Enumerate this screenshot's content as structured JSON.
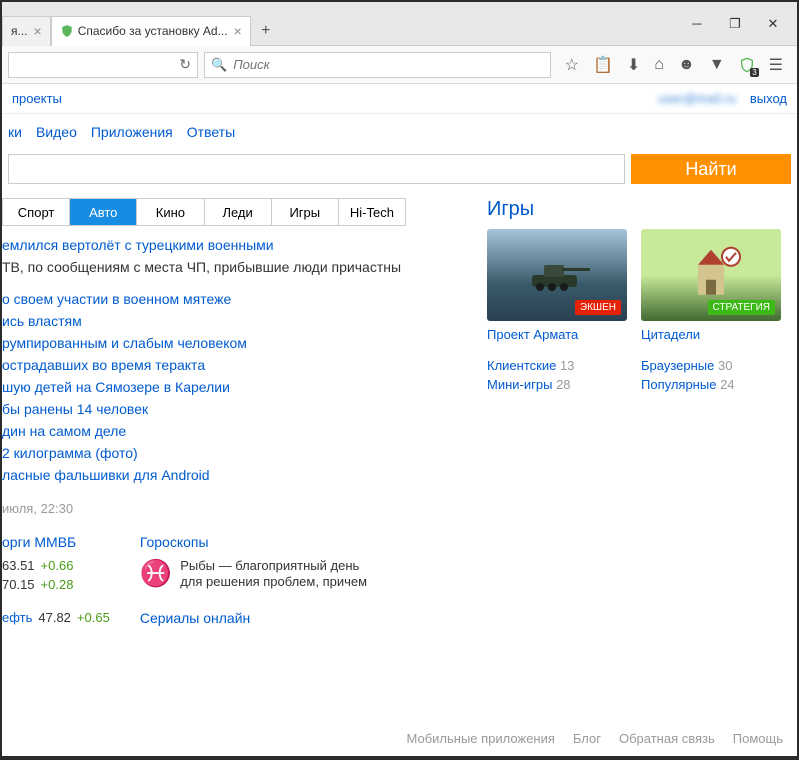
{
  "tabs": [
    {
      "label": "я...",
      "active": false
    },
    {
      "label": "Спасибо за установку Ad...",
      "active": true
    }
  ],
  "toolbar": {
    "search_placeholder": "Поиск"
  },
  "shield_badge": "3",
  "topbar": {
    "projects": "проекты",
    "logout": "выход",
    "user": "user@example"
  },
  "nav": [
    "ки",
    "Видео",
    "Приложения",
    "Ответы"
  ],
  "find_button": "Найти",
  "categories": [
    "Спорт",
    "Авто",
    "Кино",
    "Леди",
    "Игры",
    "Hi-Tech"
  ],
  "active_category": 1,
  "news": [
    "емлился вертолёт с турецкими военными",
    "о своем участии в военном мятеже",
    "ись властям",
    "румпированным и слабым человеком",
    "острадавших во время теракта",
    "шую детей на Сямозере в Карелии",
    "бы ранены 14 человек",
    "дин на самом деле",
    "2 килограмма (фото)",
    "ласные фальшивки для Android"
  ],
  "news_sub": "ТВ, по сообщениям с места ЧП, прибывшие люди причастны",
  "time": "июля, 22:30",
  "stocks": {
    "title": "орги ММВБ",
    "rows": [
      {
        "val": "63.51",
        "chg": "+0.66"
      },
      {
        "val": "70.15",
        "chg": "+0.28"
      }
    ],
    "oil_label": "ефть",
    "oil_val": "47.82",
    "oil_chg": "+0.65"
  },
  "horo": {
    "title": "Гороскопы",
    "text": "Рыбы — благоприятный день для решения проблем, причем"
  },
  "serials": "Сериалы онлайн",
  "games": {
    "title": "Игры",
    "items": [
      {
        "name": "Проект Армата",
        "tag": "ЭКШЕН"
      },
      {
        "name": "Цитадели",
        "tag": "СТРАТЕГИЯ"
      }
    ],
    "cats_left": [
      {
        "label": "Клиентские",
        "count": "13"
      },
      {
        "label": "Мини-игры",
        "count": "28"
      }
    ],
    "cats_right": [
      {
        "label": "Браузерные",
        "count": "30"
      },
      {
        "label": "Популярные",
        "count": "24"
      }
    ]
  },
  "footer": [
    "Мобильные приложения",
    "Блог",
    "Обратная связь",
    "Помощь"
  ]
}
